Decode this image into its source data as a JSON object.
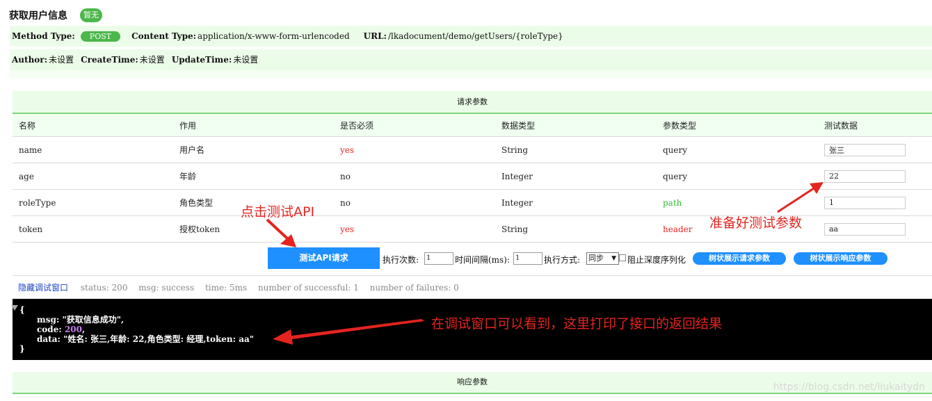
{
  "header": {
    "title": "获取用户信息",
    "badge": "暂无"
  },
  "meta": {
    "method_label": "Method Type:",
    "method_value": "POST",
    "content_type_label": "Content Type:",
    "content_type_value": "application/x-www-form-urlencoded",
    "url_label": "URL:",
    "url_value": "/lkadocument/demo/getUsers/{roleType}",
    "author_label": "Author:",
    "author_value": "未设置",
    "create_label": "CreateTime:",
    "create_value": "未设置",
    "update_label": "UpdateTime:",
    "update_value": "未设置"
  },
  "request_params": {
    "section_title": "请求参数",
    "columns": [
      "名称",
      "作用",
      "是否必须",
      "数据类型",
      "参数类型",
      "测试数据"
    ],
    "rows": [
      {
        "name": "name",
        "desc": "用户名",
        "required": "yes",
        "dtype": "String",
        "ptype": "query",
        "test": "张三"
      },
      {
        "name": "age",
        "desc": "年龄",
        "required": "no",
        "dtype": "Integer",
        "ptype": "query",
        "test": "22"
      },
      {
        "name": "roleType",
        "desc": "角色类型",
        "required": "no",
        "dtype": "Integer",
        "ptype": "path",
        "test": "1"
      },
      {
        "name": "token",
        "desc": "授权token",
        "required": "yes",
        "dtype": "String",
        "ptype": "header",
        "test": "aa"
      }
    ]
  },
  "toolbar": {
    "test_button": "测试API请求",
    "exec_count_label": "执行次数:",
    "exec_count_value": "1",
    "interval_label": "时间间隔(ms):",
    "interval_value": "1",
    "mode_label": "执行方式:",
    "mode_value": "同步",
    "block_deep_label": "阻止深度序列化",
    "tree_request_button": "树状展示请求参数",
    "tree_response_button": "树状展示响应参数"
  },
  "status": {
    "hide_debug_link": "隐藏调试窗口",
    "status": "status: 200",
    "msg": "msg: success",
    "time": "time: 5ms",
    "successful": "number of successful: 1",
    "failures": "number of failures: 0"
  },
  "console": {
    "open_brace": "{",
    "msg_line": "msg: \"获取信息成功\",",
    "code_key": "code: ",
    "code_value": "200",
    "code_comma": ",",
    "data_line": "data: \"姓名: 张三,年龄: 22,角色类型: 经理,token: aa\"",
    "close_brace": "}"
  },
  "response_params": {
    "section_title": "响应参数"
  },
  "annotations": {
    "click_test": "点击测试API",
    "prepare_params": "准备好测试参数",
    "see_result": "在调试窗口可以看到，这里打印了接口的返回结果"
  },
  "watermark": "https://blog.csdn.net/liukaitydn",
  "colors": {
    "accent_blue": "#1e90ff",
    "badge_green": "#4cb74a",
    "meta_bg": "#ebfde8",
    "annotation_red": "#e4241f"
  }
}
